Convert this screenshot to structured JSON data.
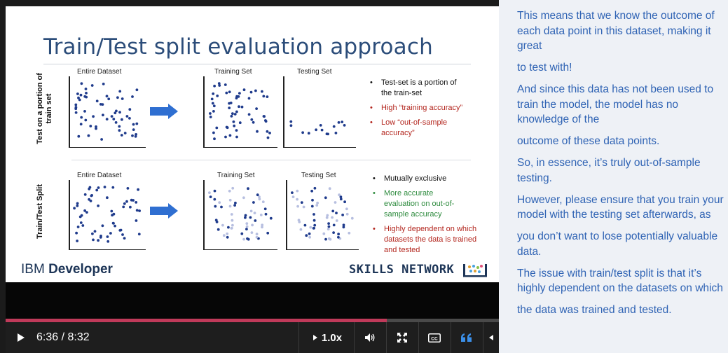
{
  "slide": {
    "title": "Train/Test split evaluation approach",
    "row1": {
      "label_line1": "Test on a portion of",
      "label_line2": "train set",
      "plot_titles": [
        "Entire Dataset",
        "Training Set",
        "Testing Set"
      ],
      "bullets": [
        {
          "text_line1": "Test-set is a portion of",
          "text_line2": "the train-set",
          "color": "#111111"
        },
        {
          "text_line1": "High “training accuracy”",
          "text_line2": "",
          "color": "#b3261e"
        },
        {
          "text_line1": "Low “out-of-sample",
          "text_line2": "accuracy”",
          "color": "#b3261e"
        }
      ]
    },
    "row2": {
      "label": "Train/Test Split",
      "plot_titles": [
        "Entire Dataset",
        "Training Set",
        "Testing Set"
      ],
      "bullets": [
        {
          "text_line1": "Mutually exclusive",
          "text_line2": "",
          "text_line3": "",
          "color": "#111111"
        },
        {
          "text_line1": "More accurate",
          "text_line2": "evaluation on out-of-",
          "text_line3": "sample accuracy",
          "color": "#2e8b3e"
        },
        {
          "text_line1": "Highly dependent on which",
          "text_line2": "datasets the data is trained",
          "text_line3": "and tested",
          "color": "#b3261e"
        }
      ]
    },
    "brand_left_light": "IBM ",
    "brand_left_bold": "Developer",
    "brand_right": "SKILLS NETWORK",
    "colors": {
      "title": "#2c4d7a",
      "dot_dark": "#1f3b8c",
      "dot_light": "#b7bfe0",
      "arrow": "#2f6fd1"
    }
  },
  "controls": {
    "play_icon": "play-icon",
    "time": "6:36 / 8:32",
    "speed": "1.0x",
    "progress_fraction": 0.773,
    "icons": [
      "volume-icon",
      "fullscreen-icon",
      "closed-captions-icon",
      "transcript-quote-icon",
      "collapse-arrow-icon"
    ]
  },
  "transcript": {
    "lines": [
      "This means that we know the outcome of each data point in this dataset, making it great",
      "to test with!",
      "And since this data has not been used to train the model, the model has no knowledge of the",
      "outcome of these data points.",
      "So, in essence, it’s truly out-of-sample testing.",
      "However, please ensure that you train your model with the testing set afterwards, as",
      "you don’t want to lose potentially valuable data.",
      "The issue with train/test split is that it’s highly dependent on the datasets on which",
      "the data was trained and tested."
    ]
  }
}
